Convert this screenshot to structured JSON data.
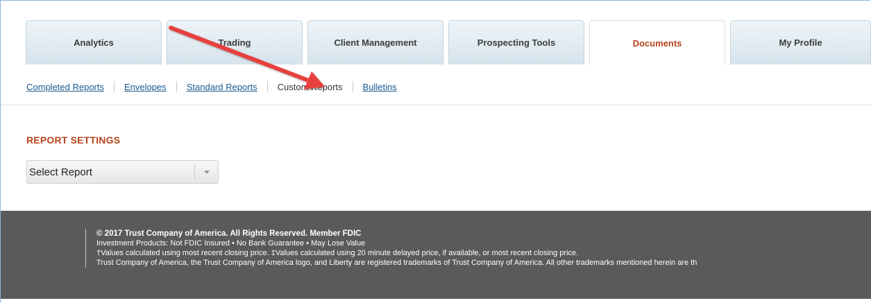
{
  "tabs": [
    {
      "label": "Analytics"
    },
    {
      "label": "Trading"
    },
    {
      "label": "Client Management"
    },
    {
      "label": "Prospecting Tools"
    },
    {
      "label": "Documents",
      "active": true
    },
    {
      "label": "My Profile"
    }
  ],
  "subnav": {
    "items": [
      {
        "label": "Completed Reports",
        "link": true
      },
      {
        "label": "Envelopes",
        "link": true
      },
      {
        "label": "Standard Reports",
        "link": true
      },
      {
        "label": "Custom Reports",
        "link": false,
        "current": true
      },
      {
        "label": "Bulletins",
        "link": true
      }
    ]
  },
  "main": {
    "section_title": "REPORT SETTINGS",
    "select": {
      "value": "Select Report",
      "icon": "chevron-down-icon"
    }
  },
  "footer": {
    "line1": "© 2017 Trust Company of America. All Rights Reserved. Member FDIC",
    "line2": "Investment Products: Not FDIC Insured • No Bank Guarantee • May Lose Value",
    "line3": "†Values calculated using most recent closing price. ‡Values calculated using 20 minute delayed price, if available, or most recent closing price.",
    "line4": "Trust Company of America, the Trust Company of America logo, and Liberty are registered trademarks of Trust Company of America. All other trademarks mentioned herein are th"
  },
  "colors": {
    "active_tab_text": "#b5431a",
    "section_title": "#b5431a",
    "link": "#1a5a8e",
    "footer_bg": "#595a5c",
    "annotation_arrow": "#e8413c"
  }
}
